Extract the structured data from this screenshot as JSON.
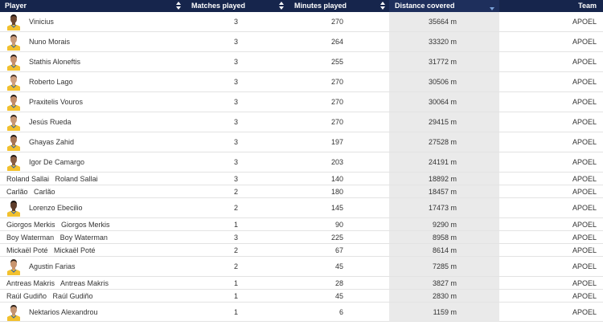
{
  "colors": {
    "header_bg": "#16254c",
    "header_sorted_bg": "#1e2f5c",
    "sort_indicator": "#7aa0d8",
    "highlight_column_bg": "#eaeaea",
    "jersey": "#f2c12e",
    "jersey_trim": "#2a5db0"
  },
  "header": {
    "player": "Player",
    "matches": "Matches played",
    "minutes": "Minutes played",
    "distance": "Distance covered",
    "team": "Team"
  },
  "players": [
    {
      "name": "Vinicius",
      "matches": "3",
      "minutes": "270",
      "distance": "35664 m",
      "team": "APOEL",
      "avatar": true,
      "skin": "#6b4630",
      "hair": "#1e1410"
    },
    {
      "name": "Nuno Morais",
      "matches": "3",
      "minutes": "264",
      "distance": "33320 m",
      "team": "APOEL",
      "avatar": true,
      "skin": "#c99a78",
      "hair": "#3b2a20"
    },
    {
      "name": "Stathis Aloneftis",
      "matches": "3",
      "minutes": "255",
      "distance": "31772 m",
      "team": "APOEL",
      "avatar": true,
      "skin": "#c7916c",
      "hair": "#2a1d16"
    },
    {
      "name": "Roberto Lago",
      "matches": "3",
      "minutes": "270",
      "distance": "30506 m",
      "team": "APOEL",
      "avatar": true,
      "skin": "#d0a07e",
      "hair": "#4a3426"
    },
    {
      "name": "Praxitelis Vouros",
      "matches": "3",
      "minutes": "270",
      "distance": "30064 m",
      "team": "APOEL",
      "avatar": true,
      "skin": "#c38d68",
      "hair": "#1f1712"
    },
    {
      "name": "Jesús Rueda",
      "matches": "3",
      "minutes": "270",
      "distance": "29415 m",
      "team": "APOEL",
      "avatar": true,
      "skin": "#c99874",
      "hair": "#2c2019"
    },
    {
      "name": "Ghayas Zahid",
      "matches": "3",
      "minutes": "197",
      "distance": "27528 m",
      "team": "APOEL",
      "avatar": true,
      "skin": "#a87654",
      "hair": "#1b1410"
    },
    {
      "name": "Igor De Camargo",
      "matches": "3",
      "minutes": "203",
      "distance": "24191 m",
      "team": "APOEL",
      "avatar": true,
      "skin": "#8a5e42",
      "hair": "#1d1511"
    },
    {
      "name": "Roland Sallai   Roland Sallai",
      "matches": "3",
      "minutes": "140",
      "distance": "18892 m",
      "team": "APOEL",
      "avatar": false
    },
    {
      "name": "Carlão   Carlão",
      "matches": "2",
      "minutes": "180",
      "distance": "18457 m",
      "team": "APOEL",
      "avatar": false
    },
    {
      "name": "Lorenzo Ebecilio",
      "matches": "2",
      "minutes": "145",
      "distance": "17473 m",
      "team": "APOEL",
      "avatar": true,
      "skin": "#5e3d2a",
      "hair": "#150f0c"
    },
    {
      "name": "Giorgos Merkis   Giorgos Merkis",
      "matches": "1",
      "minutes": "90",
      "distance": "9290 m",
      "team": "APOEL",
      "avatar": false
    },
    {
      "name": "Boy Waterman   Boy Waterman",
      "matches": "3",
      "minutes": "225",
      "distance": "8958 m",
      "team": "APOEL",
      "avatar": false
    },
    {
      "name": "Mickaël Poté   Mickaël Poté",
      "matches": "2",
      "minutes": "67",
      "distance": "8614 m",
      "team": "APOEL",
      "avatar": false
    },
    {
      "name": "Agustin Farias",
      "matches": "2",
      "minutes": "45",
      "distance": "7285 m",
      "team": "APOEL",
      "avatar": true,
      "skin": "#c8956f",
      "hair": "#2b1f18"
    },
    {
      "name": "Antreas Makris   Antreas Makris",
      "matches": "1",
      "minutes": "28",
      "distance": "3827 m",
      "team": "APOEL",
      "avatar": false
    },
    {
      "name": "Raúl Gudiño   Raúl Gudiño",
      "matches": "1",
      "minutes": "45",
      "distance": "2830 m",
      "team": "APOEL",
      "avatar": false
    },
    {
      "name": "Nektarios Alexandrou",
      "matches": "1",
      "minutes": "6",
      "distance": "1159 m",
      "team": "APOEL",
      "avatar": true,
      "skin": "#c69470",
      "hair": "#2d211a"
    }
  ]
}
